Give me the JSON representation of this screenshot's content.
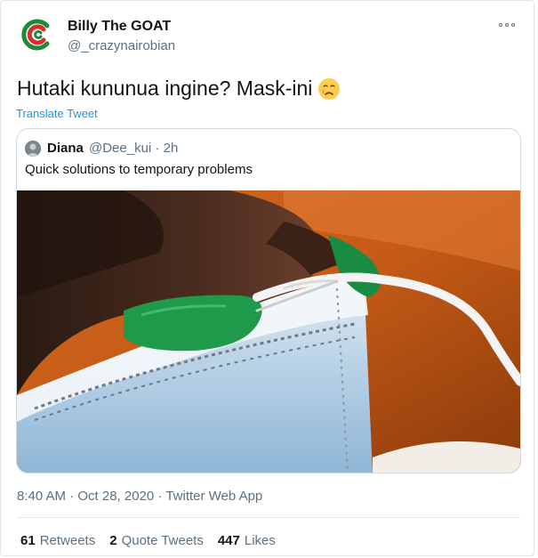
{
  "author": {
    "name": "Billy The GOAT",
    "handle": "@_crazynairobian"
  },
  "tweet": {
    "text": "Hutaki kununua ingine? Mask-ini",
    "emoji": "crying-face-emoji",
    "translate_label": "Translate Tweet"
  },
  "quoted_tweet": {
    "name": "Diana",
    "handle": "@Dee_kui",
    "time": "· 2h",
    "text": "Quick solutions to temporary problems",
    "image": "photo-hand-sewing-needle-face-mask"
  },
  "timestamp": "8:40 AM · Oct 28, 2020 · Twitter Web App",
  "stats": {
    "retweets": {
      "count": "61",
      "label": "Retweets"
    },
    "quotes": {
      "count": "2",
      "label": "Quote Tweets"
    },
    "likes": {
      "count": "447",
      "label": "Likes"
    }
  },
  "colors": {
    "link": "#1b95e0",
    "secondary_text": "#5b7083",
    "border": "#e1e8ed"
  },
  "icons": {
    "more": "more-options-icon",
    "avatar": "avatar-logo"
  }
}
